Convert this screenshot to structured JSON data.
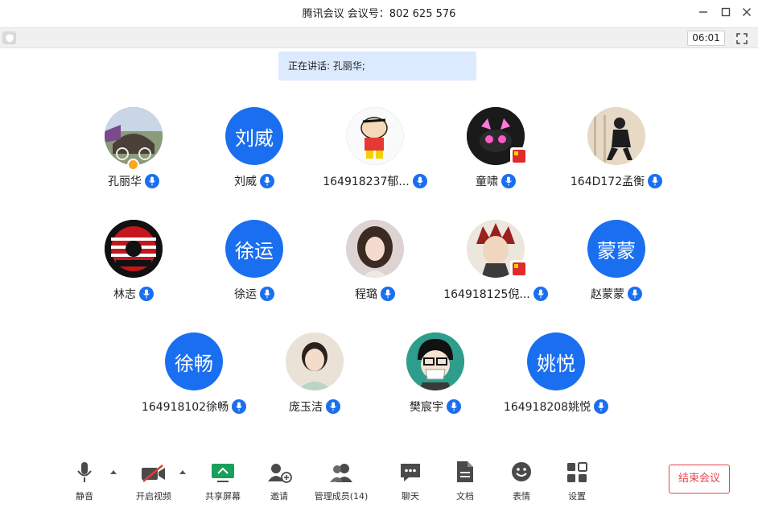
{
  "window": {
    "title": "腾讯会议 会议号：802 625 576"
  },
  "infobar": {
    "timer": "06:01"
  },
  "speaking": {
    "text": "正在讲话: 孔丽华;"
  },
  "participants": [
    {
      "name": "孔丽华",
      "avatar_type": "photo",
      "avatar_text": "",
      "badge": "host"
    },
    {
      "name": "刘威",
      "avatar_type": "text",
      "avatar_text": "刘威",
      "badge": ""
    },
    {
      "name": "164918237郁...",
      "avatar_type": "photo",
      "avatar_text": "",
      "badge": ""
    },
    {
      "name": "童啸",
      "avatar_type": "photo",
      "avatar_text": "",
      "badge": "flag"
    },
    {
      "name": "164D172孟衡",
      "avatar_type": "photo",
      "avatar_text": "",
      "badge": ""
    },
    {
      "name": "林志",
      "avatar_type": "photo",
      "avatar_text": "",
      "badge": ""
    },
    {
      "name": "徐运",
      "avatar_type": "text",
      "avatar_text": "徐运",
      "badge": ""
    },
    {
      "name": "程璐",
      "avatar_type": "photo",
      "avatar_text": "",
      "badge": ""
    },
    {
      "name": "164918125倪...",
      "avatar_type": "photo",
      "avatar_text": "",
      "badge": "flag"
    },
    {
      "name": "赵蒙蒙",
      "avatar_type": "text",
      "avatar_text": "蒙蒙",
      "badge": ""
    },
    {
      "name": "164918102徐畅",
      "avatar_type": "text",
      "avatar_text": "徐畅",
      "badge": ""
    },
    {
      "name": "庞玉洁",
      "avatar_type": "photo",
      "avatar_text": "",
      "badge": ""
    },
    {
      "name": "樊宸宇",
      "avatar_type": "photo",
      "avatar_text": "",
      "badge": ""
    },
    {
      "name": "164918208姚悦",
      "avatar_type": "text",
      "avatar_text": "姚悦",
      "badge": ""
    }
  ],
  "toolbar": {
    "mute": "静音",
    "video": "开启视频",
    "share": "共享屏幕",
    "invite": "邀请",
    "members": "管理成员(14)",
    "chat": "聊天",
    "docs": "文档",
    "emoji": "表情",
    "settings": "设置",
    "end": "结束会议"
  },
  "colors": {
    "accent": "#1a6ff0",
    "end_red": "#e5484d",
    "speaking_bg": "#dceaff",
    "share_green": "#1aa05a"
  }
}
